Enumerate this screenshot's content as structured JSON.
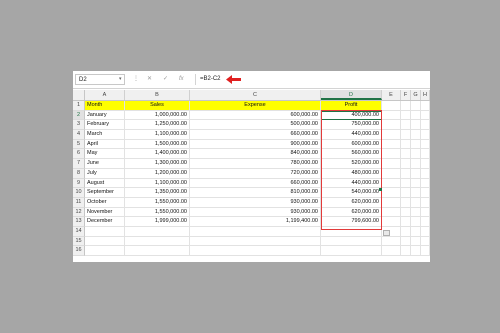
{
  "formula_bar": {
    "name_box": "D2",
    "cancel_icon": "✕",
    "enter_icon": "✓",
    "function_icon": "fx",
    "formula": "=B2-C2"
  },
  "columns": [
    "A",
    "B",
    "C",
    "D",
    "E",
    "F",
    "G",
    "H"
  ],
  "selected_column": "D",
  "row_numbers": [
    "1",
    "2",
    "3",
    "4",
    "5",
    "6",
    "7",
    "8",
    "9",
    "10",
    "11",
    "12",
    "13",
    "14",
    "15",
    "16"
  ],
  "selected_row": "2",
  "headers": {
    "month": "Month",
    "sales": "Sales",
    "expense": "Expense",
    "profit": "Profit"
  },
  "rows": [
    {
      "month": "January",
      "sales": "1,000,000.00",
      "expense": "600,000.00",
      "profit": "400,000.00"
    },
    {
      "month": "February",
      "sales": "1,250,000.00",
      "expense": "500,000.00",
      "profit": "750,000.00"
    },
    {
      "month": "March",
      "sales": "1,100,000.00",
      "expense": "660,000.00",
      "profit": "440,000.00"
    },
    {
      "month": "April",
      "sales": "1,500,000.00",
      "expense": "900,000.00",
      "profit": "600,000.00"
    },
    {
      "month": "May",
      "sales": "1,400,000.00",
      "expense": "840,000.00",
      "profit": "560,000.00"
    },
    {
      "month": "June",
      "sales": "1,300,000.00",
      "expense": "780,000.00",
      "profit": "520,000.00"
    },
    {
      "month": "July",
      "sales": "1,200,000.00",
      "expense": "720,000.00",
      "profit": "480,000.00"
    },
    {
      "month": "August",
      "sales": "1,100,000.00",
      "expense": "660,000.00",
      "profit": "440,000.00"
    },
    {
      "month": "September",
      "sales": "1,350,000.00",
      "expense": "810,000.00",
      "profit": "540,000.00"
    },
    {
      "month": "October",
      "sales": "1,550,000.00",
      "expense": "930,000.00",
      "profit": "620,000.00"
    },
    {
      "month": "November",
      "sales": "1,550,000.00",
      "expense": "930,000.00",
      "profit": "620,000.00"
    },
    {
      "month": "December",
      "sales": "1,999,000.00",
      "expense": "1,199,400.00",
      "profit": "799,600.00"
    }
  ],
  "colors": {
    "header_fill": "#ffff00",
    "highlight_border": "#e23a3a",
    "selection": "#217346",
    "background": "#a6a6a6"
  },
  "icons": {
    "name_box_dropdown": "chevron-down-icon",
    "formula_arrow": "red-arrow-icon",
    "paste_options": "paste-options-icon"
  }
}
